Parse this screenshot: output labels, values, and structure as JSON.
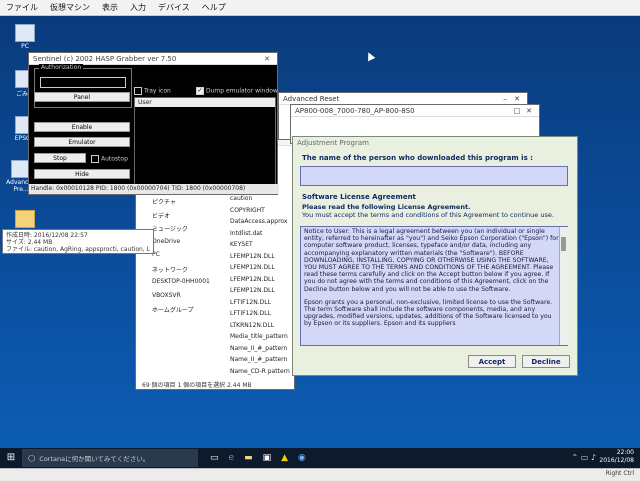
{
  "vm_menu": [
    "ファイル",
    "仮想マシン",
    "表示",
    "入力",
    "デバイス",
    "ヘルプ"
  ],
  "desktop_icons": [
    {
      "label": "PC"
    },
    {
      "label": "ごみ箱"
    },
    {
      "label": "EPSON"
    },
    {
      "label": "Advanced Pre..."
    }
  ],
  "hasp_window": {
    "title": "Sentinel (c) 2002 HASP Grabber ver 7.50",
    "group_label": "Authorization",
    "buttons": [
      "Panel",
      "Enable",
      "Emulator",
      "Stop",
      "Hide"
    ],
    "checkboxes": [
      {
        "label": "Tray icon",
        "checked": false
      },
      {
        "label": "Dump emulator window",
        "checked": true
      },
      {
        "label": "Autostop",
        "checked": false
      }
    ],
    "list_header": "User",
    "status": "Handle: 0x00010128   PID: 1800 (0x00000704)   TID: 1800 (0x00000708)"
  },
  "back_window_1": {
    "title": "Advanced Reset"
  },
  "back_window_2": {
    "title": "AP800-008_7000-780_AP-800-8S0"
  },
  "explorer": {
    "nav_items": [
      "ピクチャ",
      "ビデオ",
      "ミュージック",
      "OneDrive",
      "PC",
      "ネットワーク",
      "DESKTOP-0HH0001",
      "VBOXSVR",
      "ホームグループ"
    ],
    "files": [
      "caution",
      "COPYRIGHT",
      "DataAccess.approx",
      "Intdlist.dat",
      "KEYSET",
      "LFEMP12N.DLL",
      "LFEMP12N.DLL",
      "LFEMP12N.DLL",
      "LFEMP12N.DLL",
      "LFTIF12N.DLL",
      "LFTIF12N.DLL",
      "LTKRN12N.DLL",
      "Media_title_pattern",
      "Name_II_#_pattern",
      "Name_II_#_pattern",
      "Name_CD-R pattern"
    ],
    "status": "69 個の項目   1 個の項目を選択  2.44 MB"
  },
  "tooltip": {
    "line1": "作成日時: 2016/12/08 22:57",
    "line2": "サイズ: 2.44 MB",
    "line3": "ファイル: caution, AgRing, appsprocti, caution, LIBUIE, ..."
  },
  "agreement": {
    "title": "Adjustment Program",
    "name_label": "The name of the person who downloaded this program is :",
    "name_value": "",
    "license_label": "Software License Agreement",
    "read_label": "Please read the following License Agreement.",
    "accept_note": "You must accept the terms and conditions of this Agreement to continue use.",
    "para1": "Notice to User: This is a legal agreement between you (an individual or single entity, referred to hereinafter as \"you\") and Seiko Epson Corporation (\"Epson\") for computer software product, licenses, typeface and/or data, including any accompanying explanatory written materials (the \"Software\"). BEFORE DOWNLOADING, INSTALLING, COPYING OR OTHERWISE USING THE SOFTWARE, YOU MUST AGREE TO THE TERMS AND CONDITIONS OF THE AGREEMENT. Please read these terms carefully and click on the Accept button below if you agree. If you do not agree with the terms and conditions of this Agreement, click on the Decline button below and you will not be able to use the Software.",
    "para2": "Epson grants you a personal, non-exclusive, limited license to use the Software. The term Software shall include the software components, media, and any upgrades, modified versions, updates, additions of the Software licensed to you by Epson or its suppliers. Epson and its suppliers",
    "accept": "Accept",
    "decline": "Decline"
  },
  "taskbar": {
    "search_placeholder": "Cortanaに何か聞いてみてください。",
    "time": "22:00",
    "date": "2016/12/08"
  },
  "vm_status_right": "Right Ctrl"
}
